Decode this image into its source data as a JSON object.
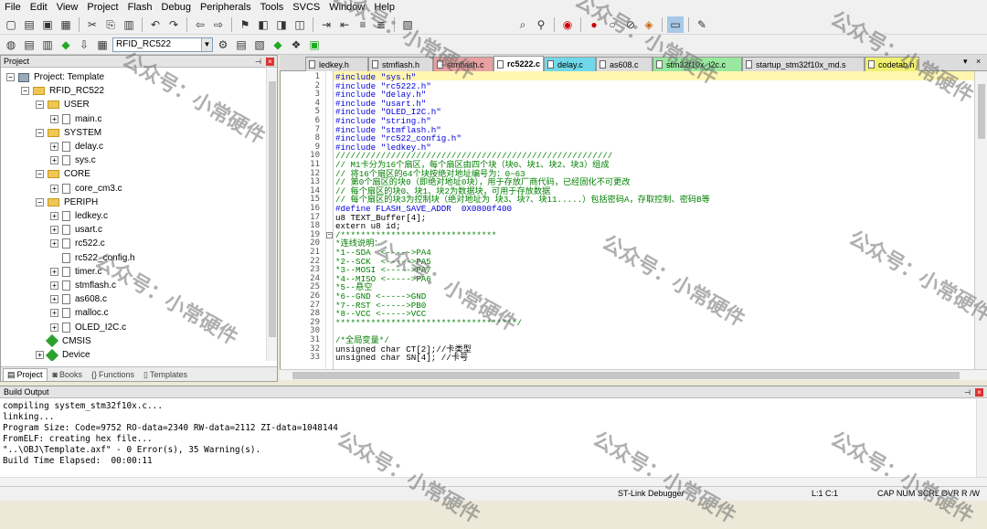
{
  "menu": [
    "File",
    "Edit",
    "View",
    "Project",
    "Flash",
    "Debug",
    "Peripherals",
    "Tools",
    "SVCS",
    "Window",
    "Help"
  ],
  "toolbar": {
    "target_name": "RFID_RC522"
  },
  "project_panel": {
    "title": "Project",
    "root": "Project: Template",
    "target": "RFID_RC522",
    "groups": [
      {
        "name": "USER",
        "files": [
          "main.c"
        ]
      },
      {
        "name": "SYSTEM",
        "files": [
          "delay.c",
          "sys.c"
        ]
      },
      {
        "name": "CORE",
        "files": [
          "core_cm3.c"
        ]
      },
      {
        "name": "PERIPH",
        "files": [
          "ledkey.c",
          "usart.c",
          "rc522.c",
          "rc522_config.h",
          "timer.c",
          "stmflash.c",
          "as608.c",
          "malloc.c",
          "OLED_I2C.c"
        ]
      },
      {
        "name": "CMSIS",
        "files": []
      },
      {
        "name": "Device",
        "files": []
      }
    ],
    "tabs": [
      "Project",
      "Books",
      "Functions",
      "Templates"
    ]
  },
  "editor": {
    "tabs": [
      {
        "label": "ledkey.h",
        "color": "#dcdcdc"
      },
      {
        "label": "stmflash.h",
        "color": "#dcdcdc"
      },
      {
        "label": "stmflash.c",
        "color": "#e8a0a0"
      },
      {
        "label": "rc5222.c",
        "color": "#ffffff",
        "active": true
      },
      {
        "label": "delay.c",
        "color": "#70d8e8"
      },
      {
        "label": "as608.c",
        "color": "#dcdcdc"
      },
      {
        "label": "stm32f10x_i2c.c",
        "color": "#98e8a0"
      },
      {
        "label": "startup_stm32f10x_md.s",
        "color": "#dcdcdc"
      },
      {
        "label": "codetab.h",
        "color": "#f0f070"
      }
    ],
    "lines": [
      "#include \"sys.h\"",
      "#include \"rc5222.h\"",
      "#include \"delay.h\"",
      "#include \"usart.h\"",
      "#include \"OLED_I2C.h\"",
      "#include \"string.h\"",
      "#include \"stmflash.h\"",
      "#include \"rc522_config.h\"",
      "#include \"ledkey.h\"",
      "///////////////////////////////////////////////////////",
      "// M1卡分为16个扇区，每个扇区由四个块（块0、块1、块2、块3）组成",
      "// 将16个扇区的64个块按绝对地址编号为：0~63",
      "// 第0个扇区的块0（即绝对地址0块），用于存放厂商代码，已经固化不可更改",
      "// 每个扇区的块0、块1、块2为数据块，可用于存放数据",
      "// 每个扇区的块3为控制块（绝对地址为 块3、块7、块11.....）包括密码A，存取控制、密码B等",
      "#define FLASH_SAVE_ADDR  0X0800f400",
      "u8 TEXT_Buffer[4];",
      "extern u8 id;",
      "/*******************************",
      "*连线说明：",
      "*1--SDA  <----->PA4",
      "*2--SCK  <----->PA5",
      "*3--MOSI <----->PA7",
      "*4--MISO <----->PA6",
      "*5--悬空",
      "*6--GND <----->GND",
      "*7--RST <----->PB0",
      "*8--VCC <----->VCC",
      "************************************/",
      "",
      "/*全局变量*/",
      "unsigned char CT[2];//卡类型",
      "unsigned char SN[4]; //卡号"
    ]
  },
  "build": {
    "title": "Build Output",
    "lines": [
      "compiling system_stm32f10x.c...",
      "linking...",
      "Program Size: Code=9752 RO-data=2340 RW-data=2112 ZI-data=1048144",
      "FromELF: creating hex file...",
      "\"..\\OBJ\\Template.axf\" - 0 Error(s), 35 Warning(s).",
      "Build Time Elapsed:  00:00:11"
    ]
  },
  "status": {
    "debugger": "ST-Link Debugger",
    "position": "L:1 C:1",
    "flags": "CAP  NUM  SCRL  OVR  R /W"
  },
  "watermark": "公众号：小常硬件"
}
